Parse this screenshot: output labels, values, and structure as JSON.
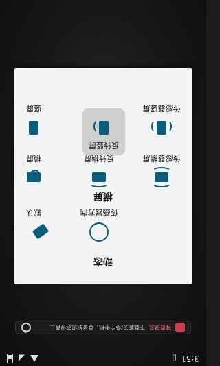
{
  "status": {
    "time": "3:51"
  },
  "search": {
    "tag": "神奇提示",
    "text": "下载聊天/多个手机，登录到您的设备..."
  },
  "dialog": {
    "sections": {
      "dynamic": "动态",
      "landscape": "横屏",
      "portrait": "竖屏"
    },
    "dynamic_opts": [
      {
        "label": "默认"
      },
      {
        "label": "传感器方向"
      }
    ],
    "landscape_opts": [
      {
        "label": "横屏"
      },
      {
        "label": "反转横屏"
      },
      {
        "label": "传感器横屏"
      }
    ],
    "portrait_opts": [
      {
        "label": "竖屏"
      },
      {
        "label": "反转竖屏"
      },
      {
        "label": "传感器竖屏"
      }
    ],
    "selected": "反转竖屏"
  },
  "colors": {
    "accent": "#0a5e7c",
    "dialog_bg": "#f1f3f4"
  }
}
